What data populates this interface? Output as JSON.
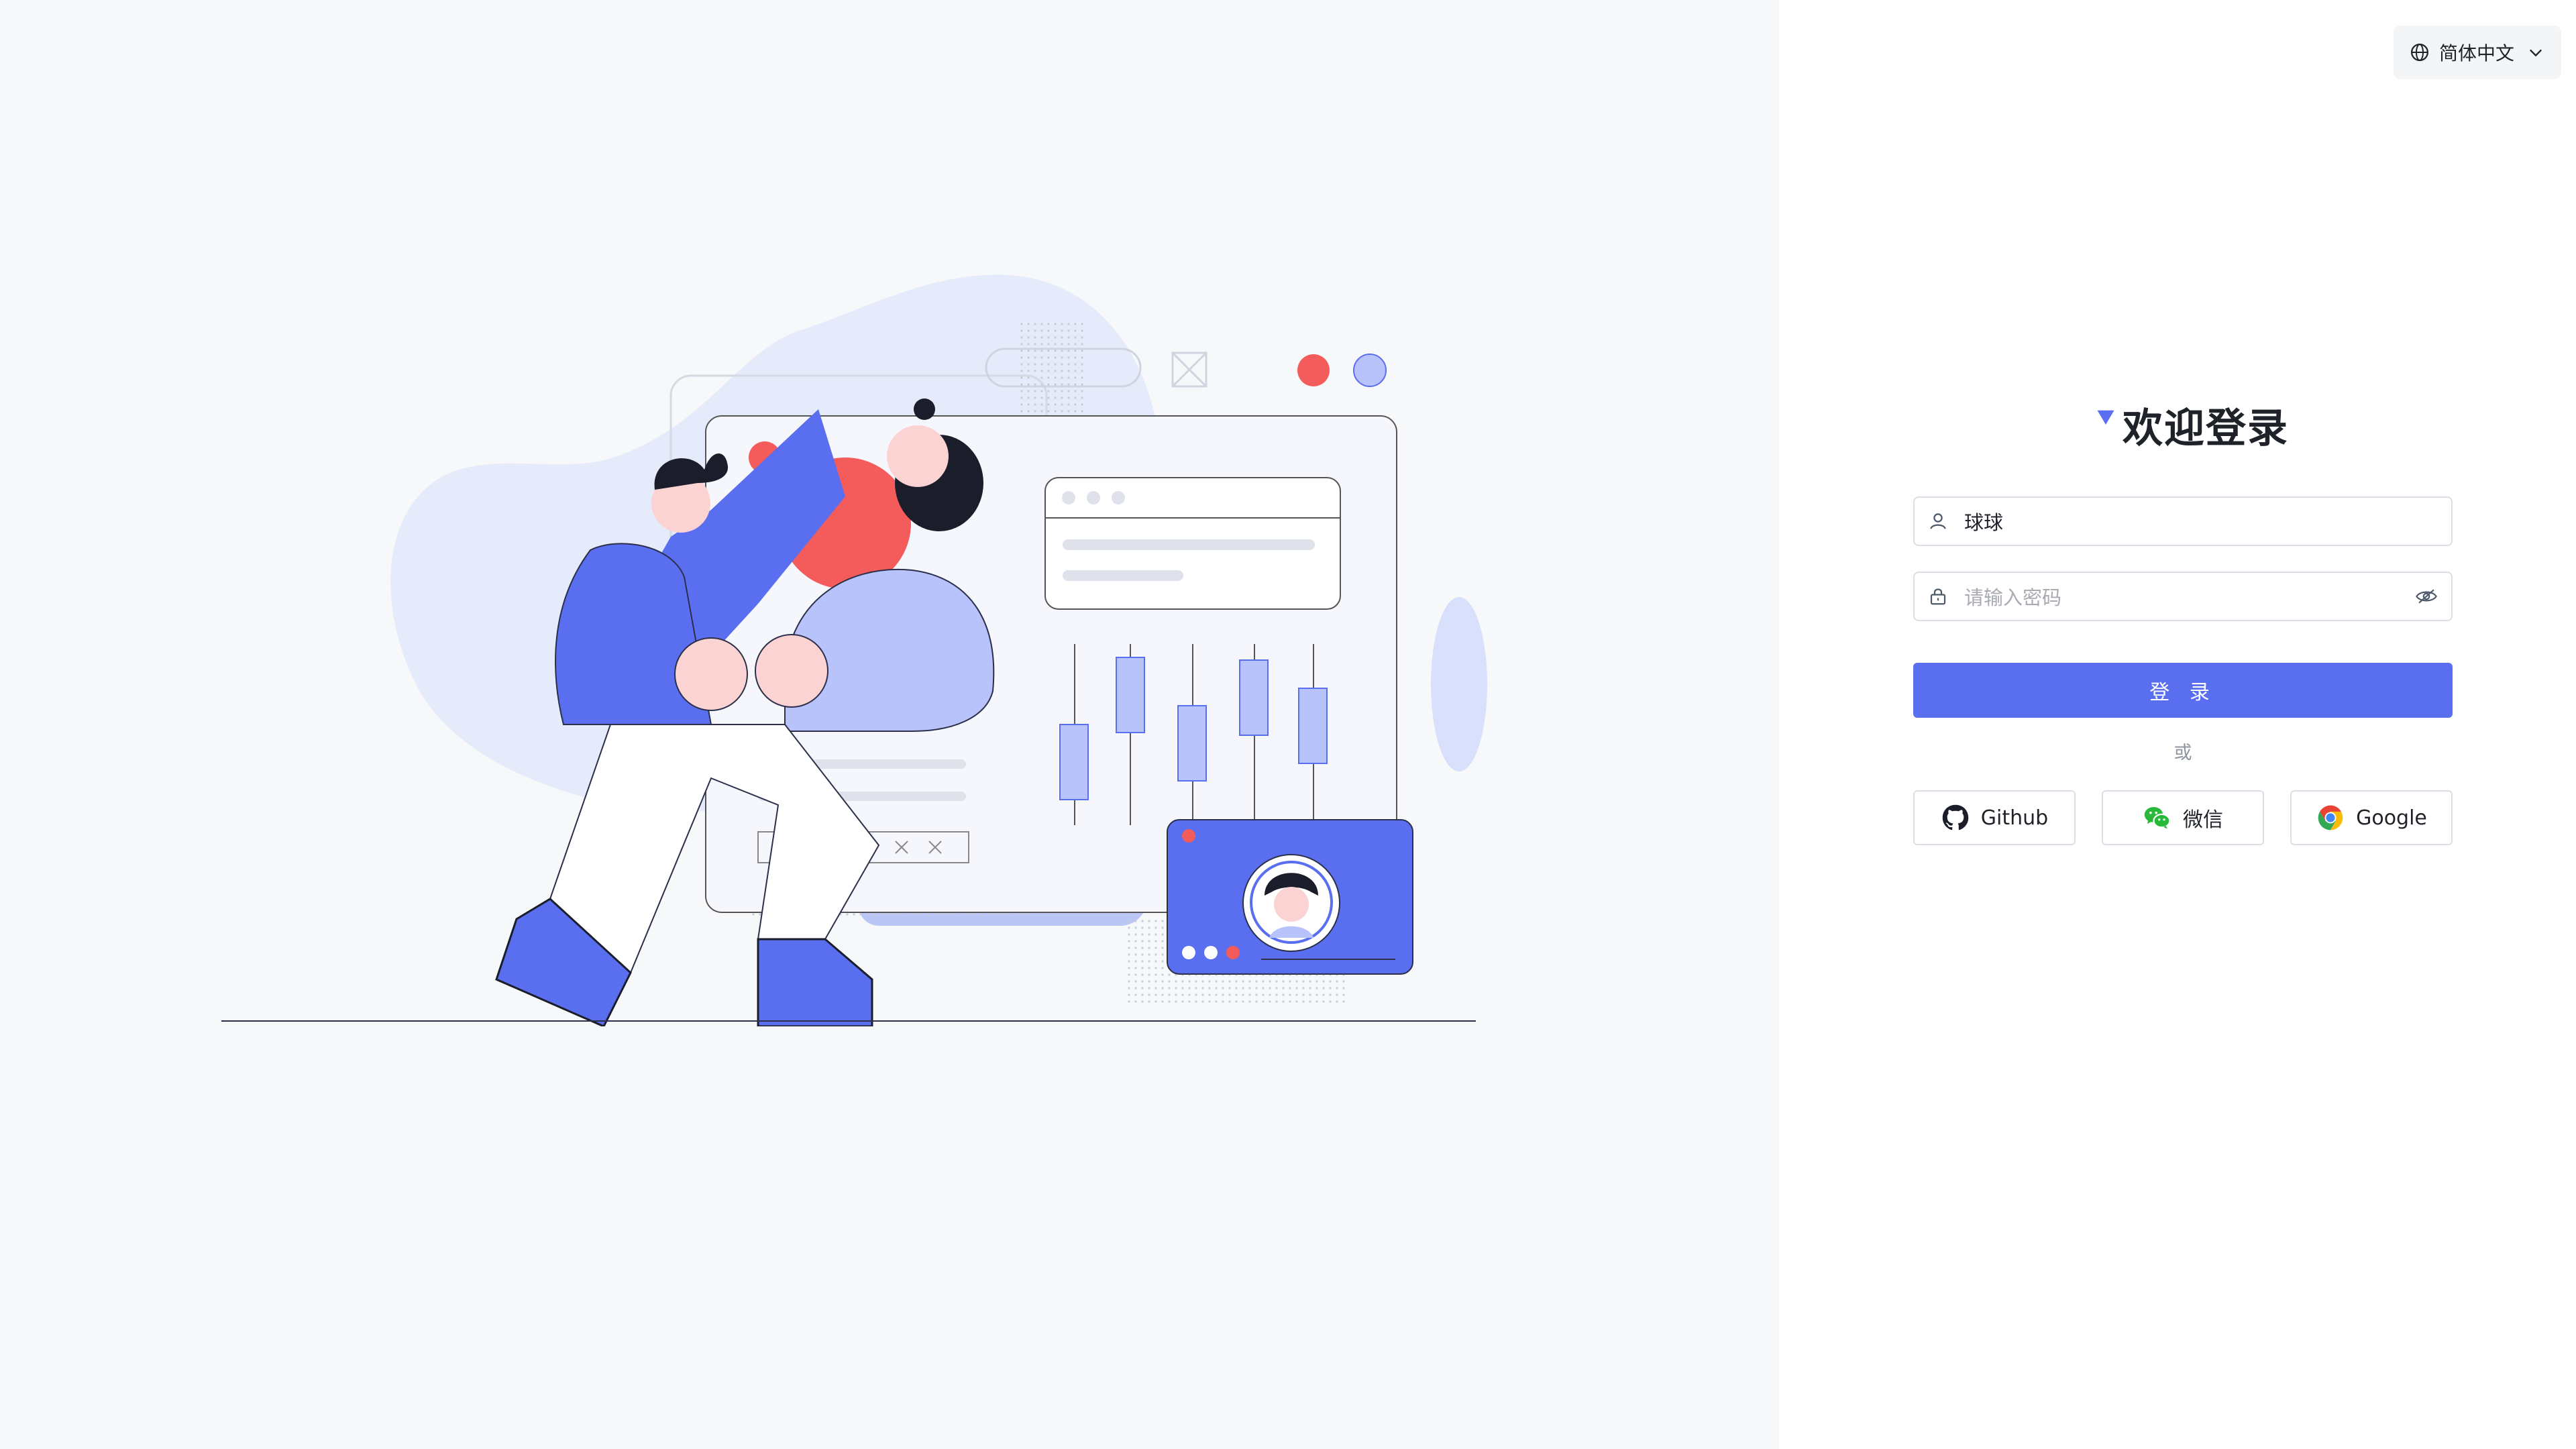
{
  "language": {
    "label": "简体中文",
    "icon": "globe-icon",
    "chevron": "chevron-down-icon"
  },
  "login": {
    "title": "欢迎登录",
    "username": {
      "value": "球球",
      "icon": "user-icon"
    },
    "password": {
      "placeholder": "请输入密码",
      "icon": "lock-icon",
      "toggle_icon": "eye-off-icon"
    },
    "submit_label": "登 录",
    "divider": "或",
    "social": [
      {
        "label": "Github",
        "icon": "github-icon"
      },
      {
        "label": "微信",
        "icon": "wechat-icon"
      },
      {
        "label": "Google",
        "icon": "chrome-icon"
      }
    ]
  },
  "colors": {
    "primary": "#5a6ef0",
    "accent_red": "#f45b5b",
    "light_blue": "#b8c2fb",
    "bg": "#f7f8fa"
  }
}
